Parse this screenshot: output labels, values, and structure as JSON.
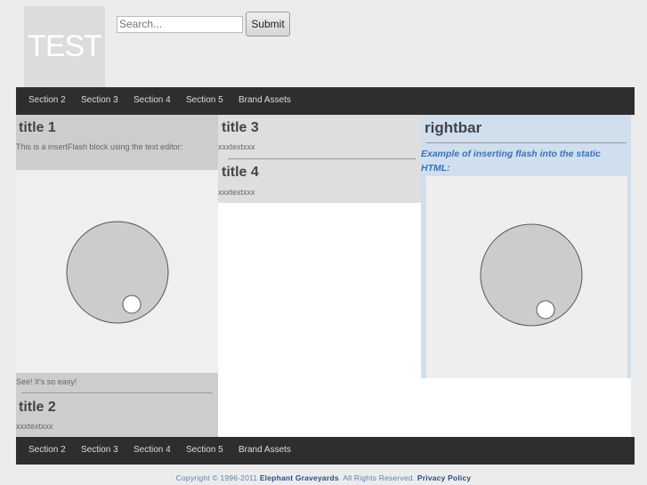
{
  "header": {
    "logo_text": "TEST",
    "search_placeholder": "Search...",
    "submit_label": "Submit"
  },
  "nav": {
    "items": [
      "Section 2",
      "Section 3",
      "Section 4",
      "Section 5",
      "Brand Assets"
    ]
  },
  "left": {
    "title1": "title 1",
    "intro": "This is a insertFlash block using the text editor:",
    "outro": "See!  It's so easy!",
    "title2": "title 2",
    "text2": "xxxtextxxx"
  },
  "middle": {
    "title3": "title 3",
    "text3": "xxxtextxxx",
    "title4": "title 4",
    "text4": "xxxtextxxx"
  },
  "rightbar": {
    "title": "rightbar",
    "lead": "Example of inserting flash into the static HTML:"
  },
  "footer": {
    "copyright": "Copyright © 1996-2011",
    "company": "Elephant Graveyards",
    "rights": ". All Rights Reserved.",
    "privacy": "Privacy Policy"
  }
}
